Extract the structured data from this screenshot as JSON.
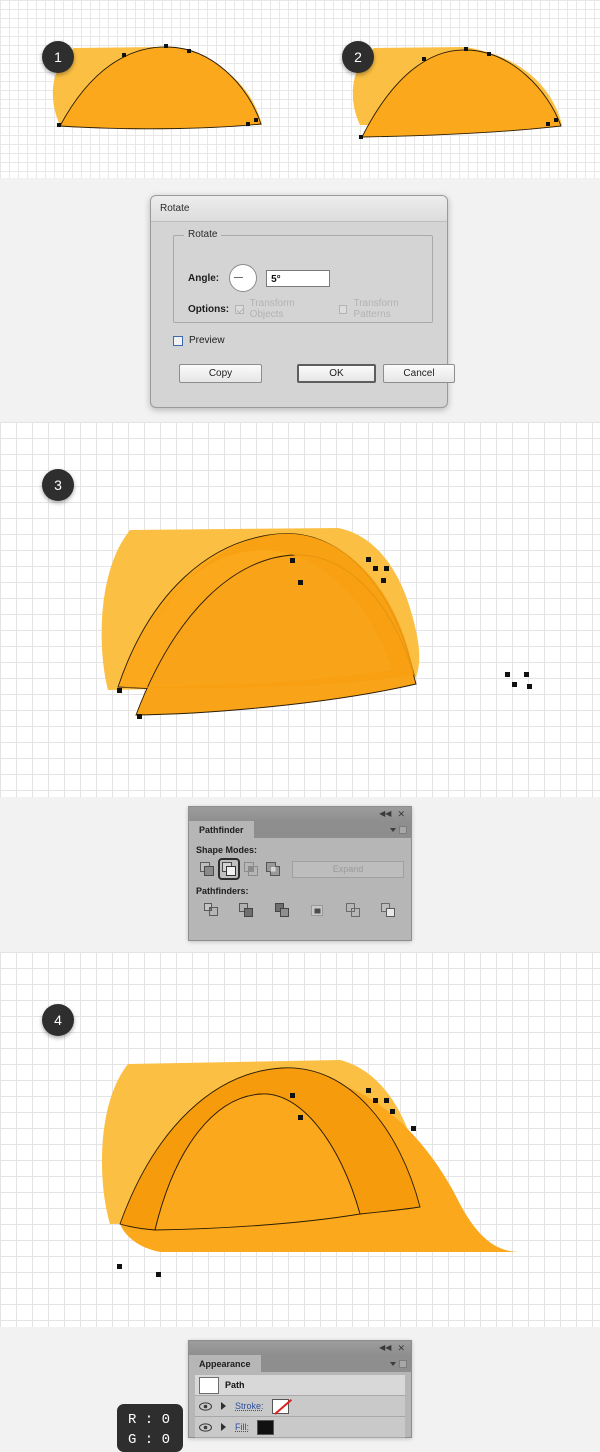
{
  "steps": [
    {
      "number": "1"
    },
    {
      "number": "2"
    },
    {
      "number": "3"
    },
    {
      "number": "4"
    }
  ],
  "colors": {
    "shape_light": "#fbc043",
    "shape_mid": "#fba81c",
    "shape_dark": "#f59b0c",
    "outline": "#2b1d05",
    "badge_bg": "#2e2e2e",
    "canvas_bg": "#ffffff",
    "page_bg": "#f2f2f2",
    "grid_line": "#e6e6e6",
    "link_text": "#2e4f9e",
    "none_slash": "#e02020"
  },
  "rotate_dialog": {
    "title": "Rotate",
    "fieldset_legend": "Rotate",
    "angle_label": "Angle:",
    "angle_value": "5°",
    "angle_dial_icon": "rotate-dial-icon",
    "options_label": "Options:",
    "transform_objects_label": "Transform Objects",
    "transform_objects_checked": true,
    "transform_objects_enabled": false,
    "transform_patterns_label": "Transform Patterns",
    "transform_patterns_checked": false,
    "transform_patterns_enabled": false,
    "preview_label": "Preview",
    "preview_checked": false,
    "buttons": {
      "copy": "Copy",
      "ok": "OK",
      "cancel": "Cancel",
      "default_button": "OK"
    }
  },
  "pathfinder_panel": {
    "tab_label": "Pathfinder",
    "collapse_icon": "collapse-double-arrow-icon",
    "close_icon": "close-x-icon",
    "menu_icon": "panel-menu-icon",
    "shape_modes_label": "Shape Modes:",
    "pathfinders_label": "Pathfinders:",
    "expand_label": "Expand",
    "expand_enabled": false,
    "shape_modes": [
      {
        "name": "unite",
        "selected": false
      },
      {
        "name": "minus-front",
        "selected": true
      },
      {
        "name": "intersect",
        "selected": false
      },
      {
        "name": "exclude",
        "selected": false
      }
    ],
    "pathfinders": [
      {
        "name": "divide"
      },
      {
        "name": "trim"
      },
      {
        "name": "merge"
      },
      {
        "name": "crop"
      },
      {
        "name": "outline"
      },
      {
        "name": "minus-back"
      }
    ]
  },
  "appearance_panel": {
    "tab_label": "Appearance",
    "collapse_icon": "collapse-double-arrow-icon",
    "close_icon": "close-x-icon",
    "menu_icon": "panel-menu-icon",
    "rows": [
      {
        "name": "path",
        "label": "Path",
        "type": "title",
        "thumbnail": "white-swatch"
      },
      {
        "name": "stroke",
        "label": "Stroke:",
        "type": "attribute",
        "swatch": "none",
        "visible": true
      },
      {
        "name": "fill",
        "label": "Fill:",
        "type": "attribute",
        "swatch": "black",
        "visible": true
      }
    ]
  },
  "color_tooltip": {
    "line1": "R : 0",
    "line2": "G : 0"
  }
}
